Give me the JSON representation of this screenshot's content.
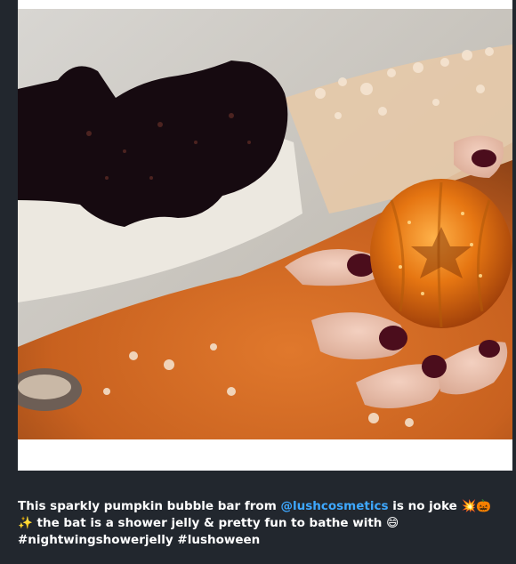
{
  "post": {
    "image_alt": "Sparkly pumpkin bubble bar and bat shower jelly in an orange bath",
    "caption": {
      "text_1": "This sparkly pumpkin bubble bar from ",
      "mention": "@lushcosmetics",
      "text_2": " is no joke ",
      "emojis_1": "💥🎃✨",
      "text_3": " the bat is a shower jelly & pretty fun to bathe with ",
      "emoji_2": "😄",
      "text_4": " #nightwingshowerjelly #lushoween"
    }
  }
}
